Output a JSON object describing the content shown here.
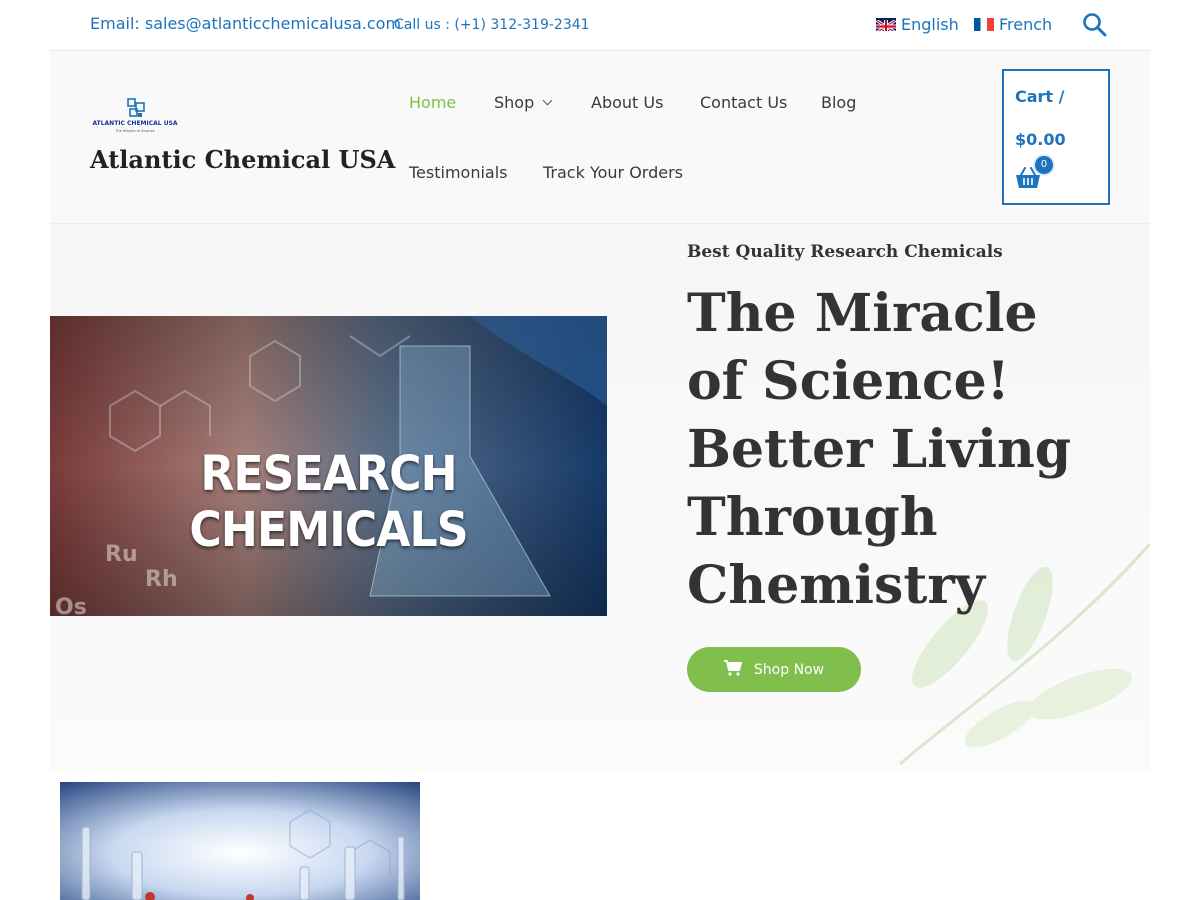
{
  "topbar": {
    "email_label": "Email:",
    "email": "sales@atlanticchemicalusa.com",
    "phone_label": "Call us : (+1) 312-319-2341",
    "languages": [
      {
        "label": "English",
        "icon": "uk-flag-icon"
      },
      {
        "label": "French",
        "icon": "france-flag-icon"
      }
    ],
    "search_icon": "search-icon"
  },
  "header": {
    "logo_text": "ATLANTIC CHEMICAL USA",
    "site_title": "Atlantic Chemical USA",
    "nav": [
      {
        "label": "Home",
        "active": true
      },
      {
        "label": "Shop",
        "dropdown": true
      },
      {
        "label": "About Us"
      },
      {
        "label": "Contact Us"
      },
      {
        "label": "Blog"
      },
      {
        "label": "Testimonials"
      },
      {
        "label": "Track Your Orders"
      }
    ],
    "cart": {
      "label": "Cart /",
      "total": "$0.00",
      "count": "0"
    }
  },
  "hero": {
    "image_text": "RESEARCH CHEMICALS",
    "subtitle": "Best Quality Research Chemicals",
    "title": "The Miracle of Science! Better Living Through Chemistry",
    "button_label": "Shop Now"
  },
  "colors": {
    "accent_blue": "#1e73be",
    "accent_green": "#81bf4c",
    "text_dark": "#333333"
  }
}
